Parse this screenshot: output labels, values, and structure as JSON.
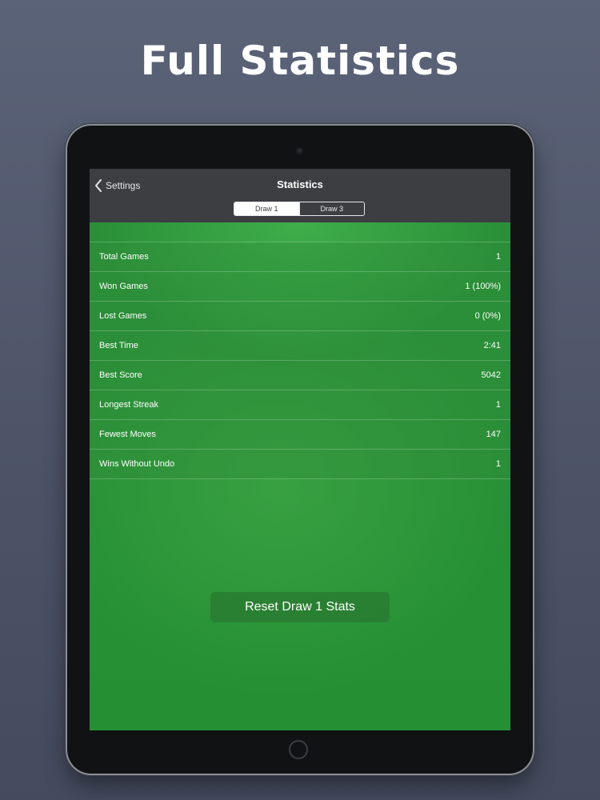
{
  "headline": "Full Statistics",
  "navbar": {
    "back_label": "Settings",
    "title": "Statistics"
  },
  "segments": [
    {
      "label": "Draw 1",
      "active": true
    },
    {
      "label": "Draw 3",
      "active": false
    }
  ],
  "stats": [
    {
      "label": "Total Games",
      "value": "1"
    },
    {
      "label": "Won Games",
      "value": "1 (100%)"
    },
    {
      "label": "Lost Games",
      "value": "0 (0%)"
    },
    {
      "label": "Best Time",
      "value": "2:41"
    },
    {
      "label": "Best Score",
      "value": "5042"
    },
    {
      "label": "Longest Streak",
      "value": "1"
    },
    {
      "label": "Fewest Moves",
      "value": "147"
    },
    {
      "label": "Wins Without Undo",
      "value": "1"
    }
  ],
  "reset_button_label": "Reset Draw 1 Stats",
  "colors": {
    "background": "#555c70",
    "navbar": "#3c3e42",
    "felt_green": "#2a8f38"
  },
  "icons": {
    "back": "chevron-left-icon"
  }
}
